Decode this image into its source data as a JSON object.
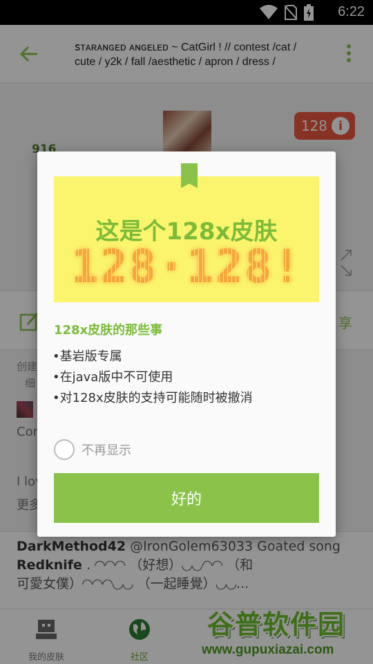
{
  "status_bar": {
    "time": "6:22",
    "icons": [
      "wifi-icon",
      "no-sim-icon",
      "battery-charging-icon"
    ]
  },
  "app_bar": {
    "title": "ꜱᴛᴀʀᴀɴɢᴇᴅ ᴀɴɢᴇʟᴇᴅ ~ CatGirl ! // contest /cat / cute / y2k / fall /aesthetic / apron / dress /"
  },
  "skin": {
    "badge_text": "128",
    "likes": "916"
  },
  "actions": {
    "share_label": "享"
  },
  "creator": {
    "line1": "创建",
    "line2": "细"
  },
  "background_text": {
    "comment_start": "Cor",
    "line_love": "I lov",
    "line_more": "更多"
  },
  "comments": [
    {
      "user": "DarkMethod42",
      "text": "@IronGolem63033 Goated song"
    },
    {
      "user": "Redknife",
      "text": ". ◜◝◜◝◜◝ （好想）◟◞◟◞◜◝◜◝ （和"
    },
    {
      "user": "",
      "text": "可愛女僕）◜◝◜◝◜◝◟◞◟◞ （一起睡覺）◟◞◟◞..."
    }
  ],
  "bottom_nav": [
    {
      "label": "我的皮肤",
      "icon": "skin-icon",
      "active": false
    },
    {
      "label": "社区",
      "icon": "globe-icon",
      "active": true
    }
  ],
  "watermark": {
    "title": "谷普软件园",
    "url": "www.gupuxiazai.com"
  },
  "dialog": {
    "banner_title": "这是个128x皮肤",
    "banner_pixel_text": "128·128!",
    "section_title": "128x皮肤的那些事",
    "bullets": [
      "•基岩版专属",
      "•在java版中不可使用",
      "•对128x皮肤的支持可能随时被撤消"
    ],
    "dont_show_label": "不再显示",
    "ok_label": "好的",
    "accent_color": "#8bc34a",
    "banner_color": "#fbf56e"
  }
}
